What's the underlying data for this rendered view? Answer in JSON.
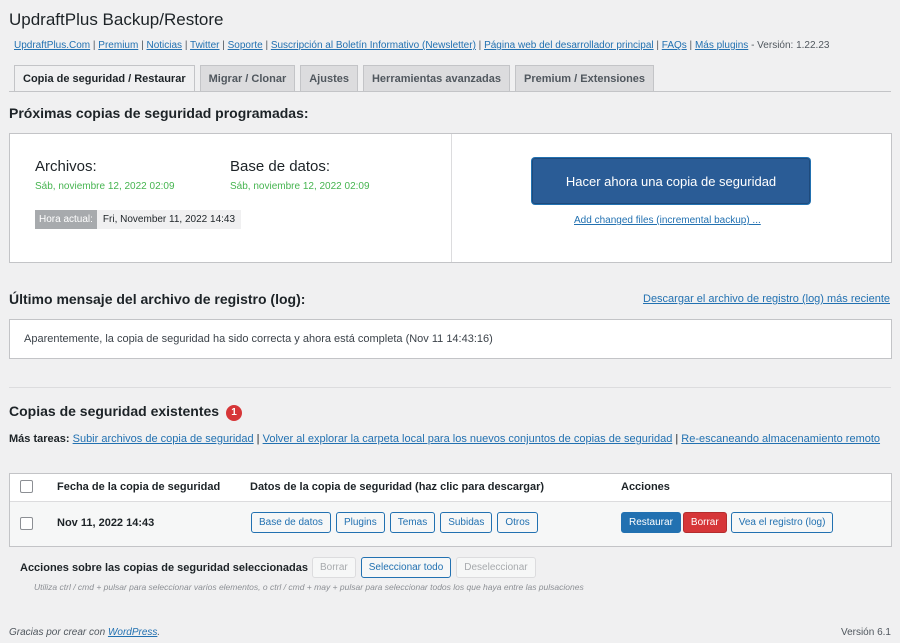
{
  "app": {
    "title": "UpdraftPlus Backup/Restore"
  },
  "links": [
    "UpdraftPlus.Com",
    "Premium",
    "Noticias",
    "Twitter",
    "Soporte",
    "Suscripción al Boletín Informativo (Newsletter)",
    "Página web del desarrollador principal",
    "FAQs",
    "Más plugins"
  ],
  "version_text": " - Versión: 1.22.23",
  "tabs": [
    {
      "label": "Copia de seguridad / Restaurar",
      "active": true
    },
    {
      "label": "Migrar / Clonar",
      "active": false
    },
    {
      "label": "Ajustes",
      "active": false
    },
    {
      "label": "Herramientas avanzadas",
      "active": false
    },
    {
      "label": "Premium / Extensiones",
      "active": false
    }
  ],
  "scheduled": {
    "heading": "Próximas copias de seguridad programadas:",
    "files_label": "Archivos:",
    "files_date": "Sáb, noviembre 12, 2022 02:09",
    "db_label": "Base de datos:",
    "db_date": "Sáb, noviembre 12, 2022 02:09",
    "current_time_label": "Hora actual:",
    "current_time_value": "Fri, November 11, 2022 14:43",
    "backup_now_label": "Hacer ahora una copia de seguridad",
    "incremental_link": "Add changed files (incremental backup) ..."
  },
  "log": {
    "heading": "Último mensaje del archivo de registro (log):",
    "download_link": "Descargar el archivo de registro (log) más reciente",
    "message": "Aparentemente, la copia de seguridad ha sido correcta y ahora está completa (Nov 11 14:43:16)"
  },
  "existing": {
    "heading": "Copias de seguridad existentes",
    "count": "1",
    "more_tasks_label": "Más tareas:",
    "task_links": [
      "Subir archivos de copia de seguridad",
      "Volver al explorar la carpeta local para los nuevos conjuntos de copias de seguridad",
      "Re-escaneando almacenamiento remoto"
    ],
    "columns": {
      "date": "Fecha de la copia de seguridad",
      "data": "Datos de la copia de seguridad (haz clic para descargar)",
      "actions": "Acciones"
    },
    "rows": [
      {
        "date": "Nov 11, 2022 14:43",
        "data_buttons": [
          "Base de datos",
          "Plugins",
          "Temas",
          "Subidas",
          "Otros"
        ],
        "restore": "Restaurar",
        "delete": "Borrar",
        "view_log": "Vea el registro (log)"
      }
    ],
    "bulk_label": "Acciones sobre las copias de seguridad seleccionadas",
    "bulk_delete": "Borrar",
    "select_all": "Seleccionar todo",
    "deselect": "Deseleccionar",
    "hint": "Utiliza ctrl / cmd + pulsar para seleccionar varios elementos, o ctrl / cmd + may + pulsar para seleccionar todos los que haya entre las pulsaciones"
  },
  "footer": {
    "thanks_prefix": "Gracias por crear con ",
    "wp_link": "WordPress",
    "thanks_suffix": ".",
    "version": "Versión 6.1"
  }
}
